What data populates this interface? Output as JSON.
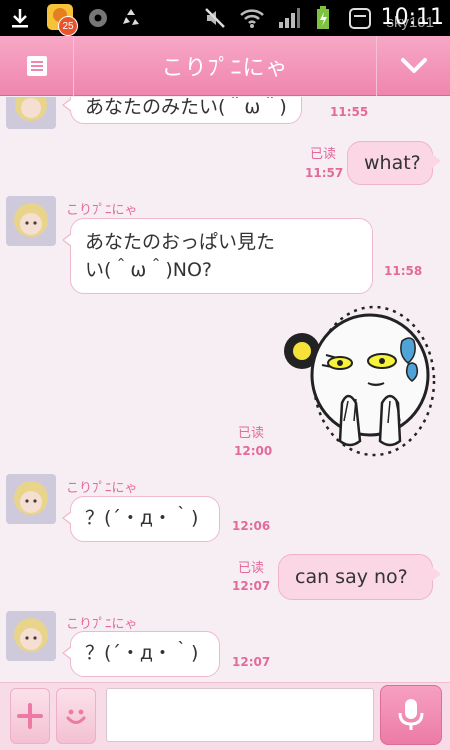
{
  "status_bar": {
    "notification_count": "25",
    "time": "10:11",
    "watermark": "sky101"
  },
  "header": {
    "title": "こりﾌﾟﾆにゃ",
    "menu_icon": "menu-icon",
    "dropdown_icon": "chevron-down-icon"
  },
  "messages": [
    {
      "side": "in",
      "text": "あなたのみたい(＾ω＾)",
      "time": "11:55"
    },
    {
      "side": "out",
      "text": "what?",
      "time": "11:57",
      "read": "已读"
    },
    {
      "side": "in",
      "sender": "こりﾌﾟﾆにゃ",
      "text_line1": "あなたのおっぱい見た",
      "text_line2": "い(＾ω＾)NO?",
      "time": "11:58"
    },
    {
      "side": "out",
      "type": "sticker",
      "sticker": "sweating-moon-face-sticker",
      "time": "12:00",
      "read": "已读"
    },
    {
      "side": "in",
      "sender": "こりﾌﾟﾆにゃ",
      "text": "？(´・д・｀)",
      "time": "12:06"
    },
    {
      "side": "out",
      "text": "can say no?",
      "time": "12:07",
      "read": "已读"
    },
    {
      "side": "in",
      "sender": "こりﾌﾟﾆにゃ",
      "text": "？(´・д・｀)",
      "time": "12:07"
    }
  ],
  "composer": {
    "input_value": "",
    "add_icon": "plus-icon",
    "emoji_icon": "smiley-icon",
    "mic_icon": "microphone-icon"
  },
  "colors": {
    "accent": "#ef86ad",
    "outgoing_bubble": "#fbd7e5",
    "timestamp": "#e36a99",
    "background": "#f6eef3"
  }
}
